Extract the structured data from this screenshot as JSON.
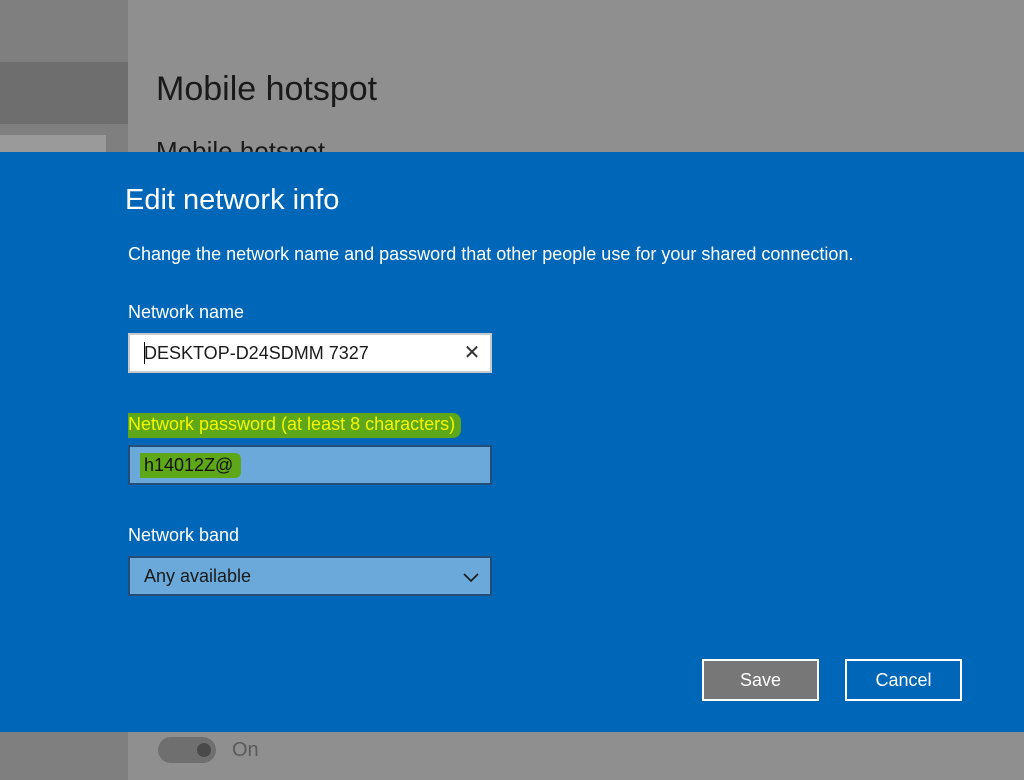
{
  "background": {
    "page_title": "Mobile hotspot",
    "section_title": "Mobile hotspot",
    "toggle_label": "On"
  },
  "dialog": {
    "title": "Edit network info",
    "description": "Change the network name and password that other people use for your shared connection.",
    "network_name": {
      "label": "Network name",
      "value": "DESKTOP-D24SDMM 7327"
    },
    "network_password": {
      "label": "Network password (at least 8 characters)",
      "value": "h14012Z@"
    },
    "network_band": {
      "label": "Network band",
      "selected": "Any available"
    },
    "buttons": {
      "save": "Save",
      "cancel": "Cancel"
    }
  },
  "colors": {
    "dialog_background": "#0067b8",
    "highlight_text": "#f4f600",
    "highlight_background": "#5da718",
    "save_button": "#777777"
  },
  "icons": {
    "clear": "close-icon",
    "dropdown": "chevron-down-icon"
  }
}
